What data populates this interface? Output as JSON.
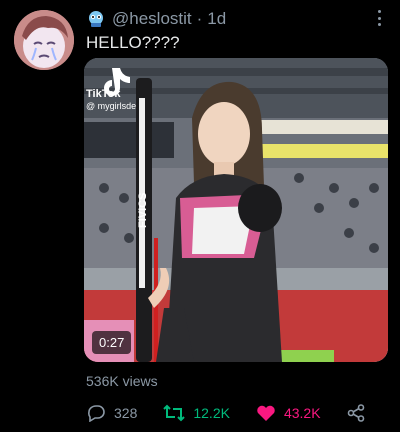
{
  "tweet": {
    "handle": "@heslostit",
    "separator": "·",
    "time": "1d",
    "text": "HELLO????",
    "views": "536K views"
  },
  "media": {
    "duration": "0:27",
    "watermark_brand": "TikTok",
    "watermark_handle": "@ mygirlsde",
    "bow_text": "FIVICS"
  },
  "actions": {
    "replies": "328",
    "retweets": "12.2K",
    "likes": "43.2K"
  },
  "icons": {
    "reply": "reply-icon",
    "retweet": "retweet-icon",
    "like": "heart-icon",
    "share": "share-icon",
    "more": "more-icon",
    "badge": "emoji-badge-icon"
  },
  "colors": {
    "retweet_active": "#00ba7c",
    "like_active": "#f91880",
    "muted": "#8b98a5"
  }
}
